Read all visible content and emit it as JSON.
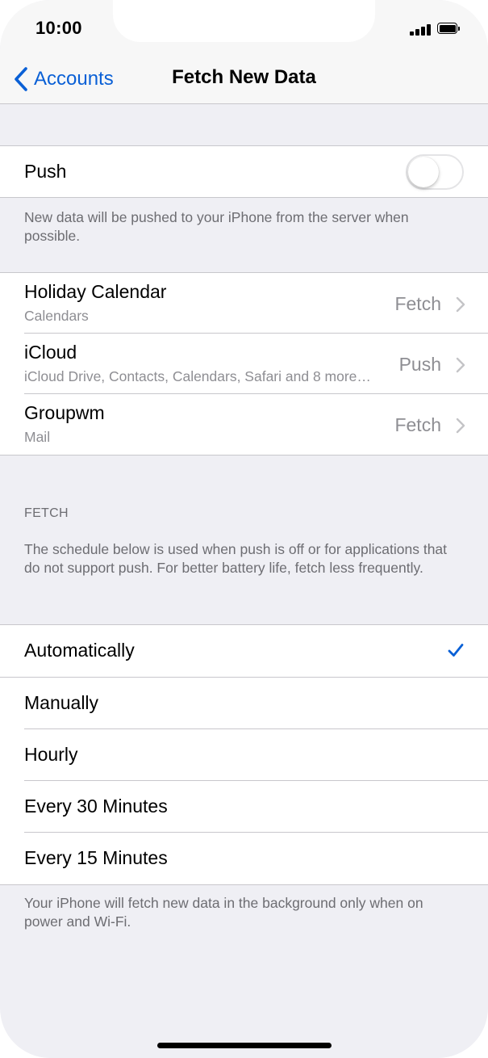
{
  "status_bar": {
    "time": "10:00"
  },
  "nav": {
    "back_label": "Accounts",
    "title": "Fetch New Data"
  },
  "push": {
    "label": "Push",
    "enabled": false,
    "footer": "New data will be pushed to your iPhone from the server when possible."
  },
  "accounts": [
    {
      "name": "Holiday Calendar",
      "detail": "Calendars",
      "value": "Fetch"
    },
    {
      "name": "iCloud",
      "detail": "iCloud Drive, Contacts, Calendars, Safari and 8 more…",
      "value": "Push"
    },
    {
      "name": "Groupwm",
      "detail": "Mail",
      "value": "Fetch"
    }
  ],
  "fetch": {
    "header": "FETCH",
    "description": "The schedule below is used when push is off or for applications that do not support push. For better battery life, fetch less frequently.",
    "options": [
      {
        "label": "Automatically",
        "selected": true
      },
      {
        "label": "Manually",
        "selected": false
      },
      {
        "label": "Hourly",
        "selected": false
      },
      {
        "label": "Every 30 Minutes",
        "selected": false
      },
      {
        "label": "Every 15 Minutes",
        "selected": false
      }
    ],
    "footer": "Your iPhone will fetch new data in the background only when on power and Wi-Fi."
  },
  "colors": {
    "accent": "#0a60d6",
    "background": "#efeff4",
    "secondary_text": "#8e8e93"
  }
}
